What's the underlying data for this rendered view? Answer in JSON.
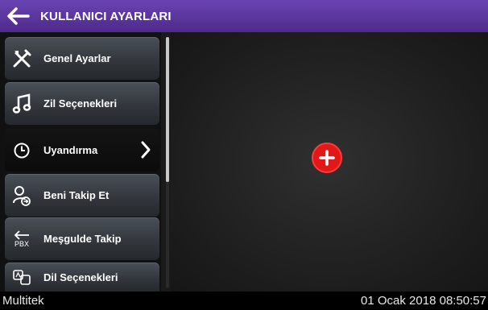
{
  "header": {
    "title": "KULLANICI AYARLARI",
    "back_icon": "arrow-left-icon"
  },
  "sidebar": {
    "items": [
      {
        "label": "Genel Ayarlar",
        "icon": "tools-icon"
      },
      {
        "label": "Zil Seçenekleri",
        "icon": "music-note-icon"
      },
      {
        "label": "Uyandırma",
        "icon": "clock-icon",
        "active": true
      },
      {
        "label": "Beni Takip Et",
        "icon": "user-forward-icon"
      },
      {
        "label": "Meşgulde Takip",
        "icon": "pbx-arrow-icon",
        "icon_text": "PBX"
      },
      {
        "label": "Dil Seçenekleri",
        "icon": "language-icon"
      }
    ]
  },
  "main": {
    "add_icon": "plus-icon",
    "accent": "#e01818"
  },
  "status": {
    "brand": "Multitek",
    "datetime": "01 Ocak 2018 08:50:57"
  },
  "colors": {
    "header": "#5a35a0",
    "accent": "#e01818"
  }
}
